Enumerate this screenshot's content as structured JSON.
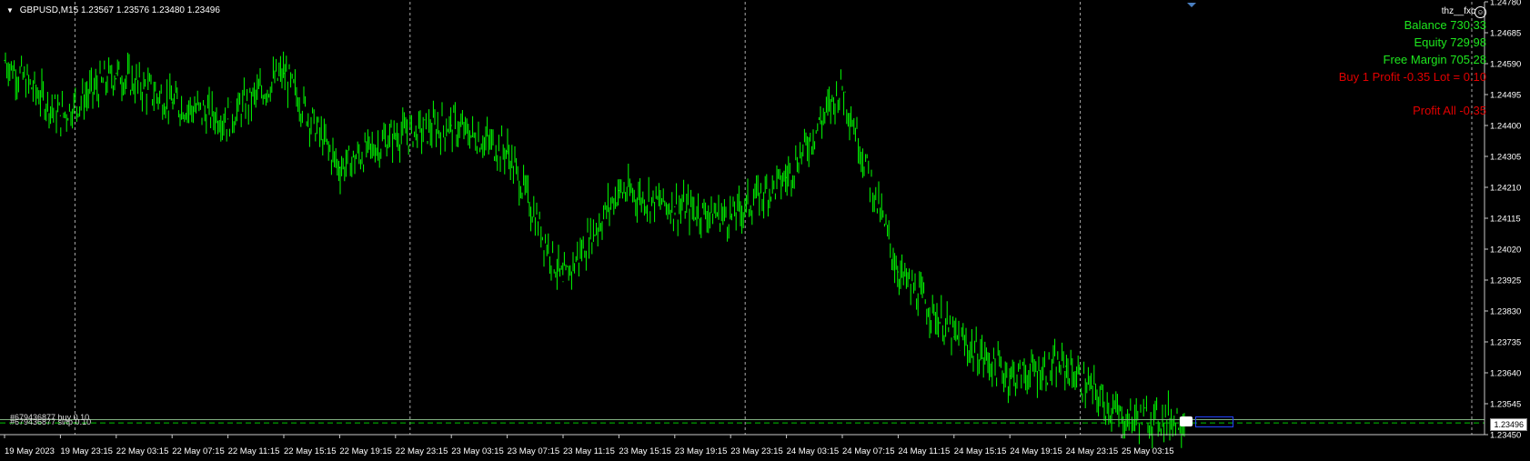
{
  "header": {
    "menu_glyph": "▼",
    "symbol": "GBPUSD,M15",
    "ohlc": "1.23567 1.23576 1.23480 1.23496"
  },
  "user_label": "thz__fxc",
  "account": {
    "balance": "Balance 730.33",
    "equity": "Equity 729.98",
    "free_margin": "Free Margin 705.28",
    "position": "Buy 1   Profit -0.35  Lot = 0.10",
    "profit_all": "Profit All -0.35"
  },
  "order_labels": [
    "#679436877 buy 0.10",
    "#679436877 sl/tp 0.10"
  ],
  "current_price": "1.23496",
  "colors": {
    "background": "#000000",
    "candle": "#00ff00",
    "grid": "#c8c8c8",
    "positive_text": "#1ee81e",
    "negative_text": "#e00000",
    "order_line": "#00c800",
    "trade_box": "#2244ff"
  },
  "chart_data": {
    "type": "line",
    "symbol": "GBPUSD",
    "timeframe": "M15",
    "ylim": [
      1.2345,
      1.2478
    ],
    "y_ticks": [
      "1.24780",
      "1.24685",
      "1.24590",
      "1.24495",
      "1.24400",
      "1.24305",
      "1.24210",
      "1.24115",
      "1.24020",
      "1.23925",
      "1.23830",
      "1.23735",
      "1.23640",
      "1.23545",
      "1.23450"
    ],
    "x_labels": [
      "19 May 2023",
      "19 May 23:15",
      "22 May 03:15",
      "22 May 07:15",
      "22 May 11:15",
      "22 May 15:15",
      "22 May 19:15",
      "22 May 23:15",
      "23 May 03:15",
      "23 May 07:15",
      "23 May 11:15",
      "23 May 15:15",
      "23 May 19:15",
      "23 May 23:15",
      "24 May 03:15",
      "24 May 07:15",
      "24 May 11:15",
      "24 May 15:15",
      "24 May 19:15",
      "24 May 23:15",
      "25 May 03:15"
    ],
    "grid": "vertical dotted",
    "series": [
      {
        "name": "GBPUSD",
        "x": [
          "19 May 2023",
          "19 May 23:15",
          "22 May 03:15",
          "22 May 07:15",
          "22 May 11:15",
          "22 May 15:15",
          "22 May 19:15",
          "22 May 23:15",
          "23 May 03:15",
          "23 May 07:15",
          "23 May 11:15",
          "23 May 15:15",
          "23 May 19:15",
          "23 May 23:15",
          "24 May 03:15",
          "24 May 07:15",
          "24 May 11:15",
          "24 May 15:15",
          "24 May 19:15",
          "24 May 23:15",
          "25 May 03:15"
        ],
        "values": [
          1.246,
          1.2443,
          1.2456,
          1.2447,
          1.2442,
          1.2456,
          1.2427,
          1.2437,
          1.244,
          1.2432,
          1.2392,
          1.242,
          1.2415,
          1.2412,
          1.2424,
          1.2452,
          1.2395,
          1.2375,
          1.2363,
          1.2366,
          1.235
        ]
      }
    ]
  }
}
